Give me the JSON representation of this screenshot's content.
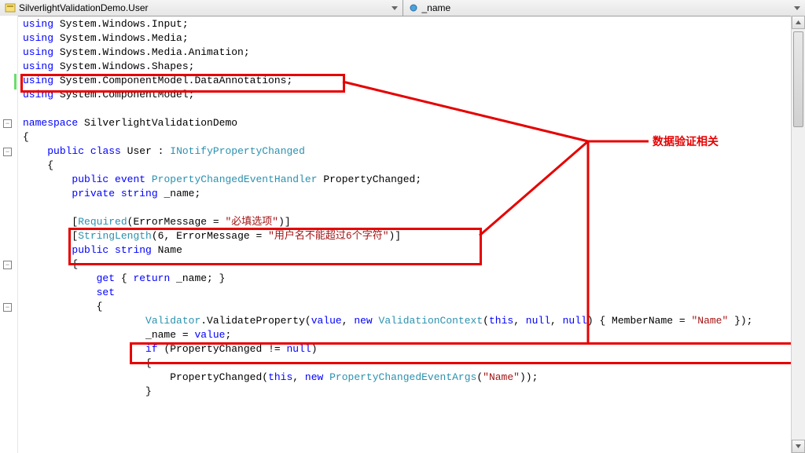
{
  "topbar": {
    "class_dropdown": "SilverlightValidationDemo.User",
    "member_dropdown": "_name"
  },
  "annotation": "数据验证相关",
  "code": {
    "l1": {
      "kw": "using",
      "rest": " System.Windows.Input;"
    },
    "l2": {
      "kw": "using",
      "rest": " System.Windows.Media;"
    },
    "l3": {
      "kw": "using",
      "rest": " System.Windows.Media.Animation;"
    },
    "l4": {
      "kw": "using",
      "rest": " System.Windows.Shapes;"
    },
    "l5": {
      "kw": "using",
      "rest": " System.ComponentModel.DataAnnotations;"
    },
    "l6": {
      "kw": "using",
      "rest": " System.ComponentModel;"
    },
    "ns": {
      "kw": "namespace",
      "rest": " SilverlightValidationDemo"
    },
    "cls": {
      "pub": "public",
      "cls": "class",
      "name": " User : ",
      "iface": "INotifyPropertyChanged"
    },
    "evt": {
      "pub": "public",
      "evt": "event",
      "type": "PropertyChangedEventHandler",
      "name": " PropertyChanged;"
    },
    "fld": {
      "priv": "private",
      "str": "string",
      "name": " _name;"
    },
    "attr1": {
      "open": "[",
      "type": "Required",
      "mid": "(ErrorMessage = ",
      "val": "\"必填选项\"",
      "close": ")]"
    },
    "attr2": {
      "open": "[",
      "type": "StringLength",
      "mid": "(6, ErrorMessage = ",
      "val": "\"用户名不能超过6个字符\"",
      "close": ")]"
    },
    "prop": {
      "pub": "public",
      "str": "string",
      "name": " Name"
    },
    "get": {
      "kw": "get",
      "body": " { ",
      "ret": "return",
      "rest": " _name; }"
    },
    "set": {
      "kw": "set"
    },
    "val": {
      "pre": "                    ",
      "cls": "Validator",
      "mid1": ".ValidateProperty(",
      "kw1": "value",
      "mid2": ", ",
      "kw2": "new",
      "sp": " ",
      "cls2": "ValidationContext",
      "mid3": "(",
      "kw3": "this",
      "mid4": ", ",
      "kw4": "null",
      "mid5": ", ",
      "kw5": "null",
      "mid6": ") { MemberName = ",
      "str": "\"Name\"",
      "end": " });"
    },
    "asn": {
      "pre": "                    _name = ",
      "kw": "value",
      "end": ";"
    },
    "ifl": {
      "pre": "                    ",
      "kw": "if",
      "rest": " (PropertyChanged != ",
      "nul": "null",
      "end": ")"
    },
    "pc": {
      "pre": "                        PropertyChanged(",
      "kw": "this",
      "mid": ", ",
      "kw2": "new",
      "sp": " ",
      "cls": "PropertyChangedEventArgs",
      "mid2": "(",
      "str": "\"Name\"",
      "end": "));"
    }
  }
}
